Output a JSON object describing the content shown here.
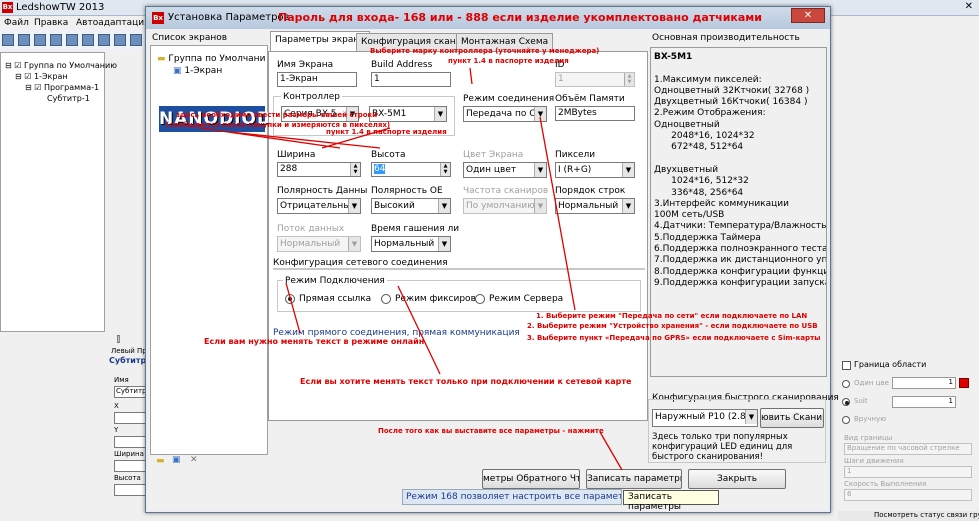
{
  "main_window": {
    "title": "LedshowTW 2013",
    "menu": [
      "Файл",
      "Правка",
      "Автоадаптация"
    ],
    "tree": [
      "Группа по Умолчанию",
      "1-Экран",
      "Программа-1",
      "Субтитр-1"
    ],
    "left_lower": {
      "tabs": [
        "Левый",
        "Пр"
      ],
      "section": "Субтитр-1",
      "name_label": "Имя",
      "name_value": "Субтитр-1",
      "x_label": "X",
      "y_label": "Y",
      "width_label": "Ширина",
      "height_label": "Высота"
    },
    "right_panel": {
      "border_label": "Граница области",
      "option1": "Один цве",
      "option2": "Suit",
      "option3": "Вручную",
      "val1": "1",
      "val2": "1",
      "border_type_label": "Вид границы",
      "border_type_value": "Вращение по часовой стрелке",
      "step_label": "Шаги движения",
      "step_value": "1",
      "speed_label": "Скорость Выполнения",
      "speed_value": "6",
      "status": "Посмотреть статус связи группы"
    },
    "bottom_icons": [
      "folder-icon",
      "screen-icon",
      "delete-icon"
    ]
  },
  "dialog": {
    "title": "Установка Параметров",
    "header_note": "Пароль для входа- 168  или - 888 если изделие укомплектовано датчиками",
    "left_tree_label": "Список экранов",
    "left_tree_items": [
      "Группа по Умолчани",
      "1-Экран"
    ],
    "logo": "NANODIOD",
    "tabs": [
      "Параметры экрана",
      "Конфигурация сканирования",
      "Монтажная Схема"
    ],
    "fields": {
      "screen_name_label": "Имя Экрана",
      "screen_name_value": "1-Экран",
      "build_address_label": "Build Address",
      "build_address_value": "1",
      "id_label": "ID",
      "id_value": "1",
      "controller_label": "Контроллер",
      "controller_series": "Серия BX-5",
      "controller_model": "BX-5M1",
      "conn_mode_label": "Режим соединения",
      "conn_mode_value": "Передача по Се",
      "memory_label": "Объём Памяти",
      "memory_value": "2MBytes",
      "width_label": "Ширина",
      "width_value": "288",
      "height_label": "Высота",
      "height_value": "64",
      "color_label": "Цвет Экрана",
      "color_value": "Один цвет",
      "pixels_label": "Пиксели",
      "pixels_value": "I  (R+G)",
      "data_polarity_label": "Полярность Данны",
      "data_polarity_value": "Отрицательный",
      "oe_polarity_label": "Полярность ОЕ",
      "oe_polarity_value": "Высокий",
      "scan_mode_label": "Частота сканиров",
      "scan_mode_value": "По умолчанию",
      "row_order_label": "Порядок строк",
      "row_order_value": "Нормальный",
      "data_flow_label": "Поток данных",
      "data_flow_value": "Нормальный",
      "blank_time_label": "Время гашения ли",
      "blank_time_value": "Нормальный"
    },
    "network_group_label": "Конфигурация сетевого соединения",
    "conn_group_label": "Режим Подключения",
    "radio": [
      "Прямая ссылка",
      "Режим фиксирова",
      "Режим Сервера"
    ],
    "direct_link_text": "Режим прямого соединения, прямая коммуникация",
    "info_title": "Основная производительность",
    "info_lines": [
      "BX-5M1",
      "",
      "1.Максимум пикселей:",
      "Одноцветный 32Ктчоки( 32768 )",
      "Двухцветный 16Ктчоки( 16384 )",
      "2.Режим Отображения:",
      "Одноцветный",
      "      2048*16, 1024*32",
      "      672*48, 512*64",
      "",
      "Двухцветный",
      "      1024*16, 512*32",
      "      336*48, 256*64",
      "3.Интерфейс коммуникации",
      "100М сеть/USB",
      "4.Датчики: Температура/Влажность",
      "5.Поддержка Таймера",
      "6.Поддержка полноэкранного теста",
      "7.Поддержка ик дистанционного управле",
      "8.Поддержка конфигурации функции кно",
      "9.Поддержка конфигурации запуска экра"
    ],
    "quick_scan_label": "Конфигурация быстрого сканирования",
    "quick_scan_value": "Наружный P10 (2.8)",
    "quick_scan_button": "ювить Сканиро",
    "quick_scan_note": "Здесь только три популярных конфигураций LED единиц для быстрого сканирования!",
    "buttons": {
      "readback": "метры Обратного Чт",
      "write": "Записать параметры",
      "close": "Закрыть"
    },
    "status_text": "Режим 168 позволяет настроить все параметры эк",
    "tooltip": "Записать параметры"
  },
  "annotations": {
    "choose_controller": "Выберите марку контроллера (уточняйте у менеджера)",
    "passport_1": "пункт 1.4 в паспорте изделия",
    "sizes_line1": "здесь необходимо ввести размеры вашей строки",
    "sizes_line2": "(сообщаются после покупки  и измеряются в пикселях)",
    "passport_2": "пункт 1.4 в паспорте изделия",
    "online_edit": "Если вам нужно менять текст в режиме онлайн",
    "network_card": "Если вы хотите менять текст только при подключении к сетевой карте",
    "lan": "1. Выберите режим  \"Передача по сети\" если подключаете по LAN",
    "usb": "2. Выберите режим \"Устройство хранения\" - если подключаете по USB",
    "gprs": "3. Выберите пункт «Передача по GPRS» если подключаете с Sim-карты",
    "after_params": "После того как вы выставите все параметры - нажмите"
  }
}
